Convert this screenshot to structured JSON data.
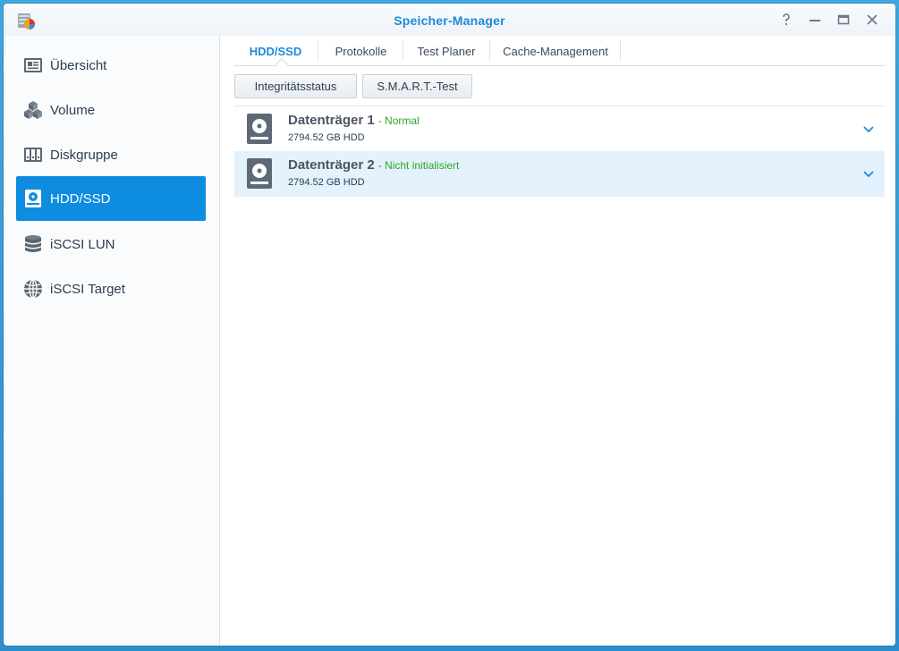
{
  "window": {
    "title": "Speicher-Manager",
    "controls": [
      "help-icon",
      "minimize-icon",
      "maximize-icon",
      "close-icon"
    ]
  },
  "sidebar": {
    "items": [
      {
        "label": "Übersicht",
        "icon": "overview-icon"
      },
      {
        "label": "Volume",
        "icon": "cubes-icon"
      },
      {
        "label": "Diskgruppe",
        "icon": "disk-group-icon"
      },
      {
        "label": "HDD/SSD",
        "icon": "hdd-icon",
        "active": true
      },
      {
        "label": "iSCSI LUN",
        "icon": "database-icon"
      },
      {
        "label": "iSCSI Target",
        "icon": "globe-icon"
      }
    ]
  },
  "tabs": [
    {
      "label": "HDD/SSD",
      "active": true
    },
    {
      "label": "Protokolle"
    },
    {
      "label": "Test Planer"
    },
    {
      "label": "Cache-Management"
    }
  ],
  "toolbar": {
    "integrity_label": "Integritätsstatus",
    "smart_label": "S.M.A.R.T.-Test"
  },
  "disks": [
    {
      "name": "Datenträger 1",
      "status": "- Normal",
      "detail": "2794.52 GB HDD",
      "selected": false
    },
    {
      "name": "Datenträger 2",
      "status": "- Nicht initialisiert",
      "detail": "2794.52 GB HDD",
      "selected": true
    }
  ],
  "colors": {
    "accent": "#1e8ad6",
    "active_nav": "#0d8ce0",
    "status_ok": "#2aa82a",
    "selected_row": "#e3f2fc"
  }
}
